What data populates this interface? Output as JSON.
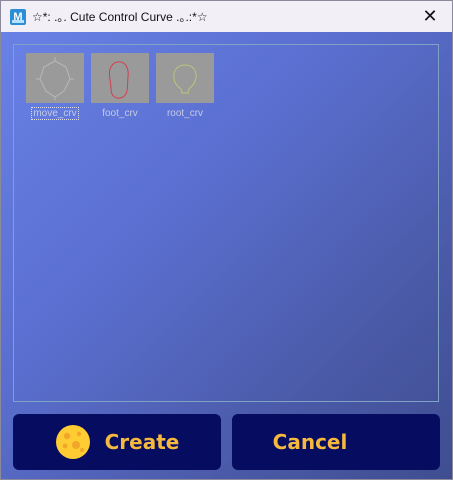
{
  "window": {
    "title": "☆*: .｡. Cute Control Curve .｡.:*☆",
    "app_icon_letter": "M",
    "close_glyph": "✕"
  },
  "gallery": {
    "items": [
      {
        "label": "move_crv",
        "selected": true
      },
      {
        "label": "foot_crv",
        "selected": false
      },
      {
        "label": "root_crv",
        "selected": false
      }
    ]
  },
  "buttons": {
    "create_label": "Create",
    "cancel_label": "Cancel"
  },
  "colors": {
    "accent_text": "#f6b93e",
    "button_bg": "#060c60"
  }
}
